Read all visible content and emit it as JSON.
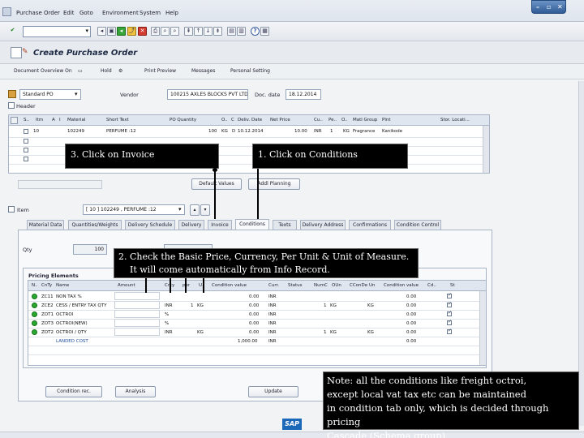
{
  "menubar": {
    "items": [
      "Purchase Order",
      "Edit",
      "Goto",
      "Environment",
      "System",
      "Help"
    ]
  },
  "title": "Create Purchase Order",
  "appbar": {
    "buttons": [
      "Document Overview On",
      "Hold",
      "Print Preview",
      "Messages",
      "Personal Setting"
    ]
  },
  "header_fields": {
    "doc_type": "Standard PO",
    "vendor_label": "Vendor",
    "vendor": "100215 AXLES BLOCKS PVT LTD",
    "doc_date_label": "Doc. date",
    "doc_date": "18.12.2014",
    "header_label": "Header"
  },
  "item_grid": {
    "columns": [
      "S..",
      "Itm",
      "A",
      "I",
      "Material",
      "Short Text",
      "PO Quantity",
      "O..",
      "C",
      "Deliv. Date",
      "Net Price",
      "Cu..",
      "Pe..",
      "O..",
      "Matl Group",
      "Plnt",
      "Stor. Locati..."
    ],
    "row": {
      "itm": "10",
      "material": "102249",
      "short_text": "PERFUME :12",
      "qty": "100",
      "oun": "KG",
      "c": "D",
      "date": "10.12.2014",
      "price": "10.00",
      "cur": "INR",
      "per": "1",
      "opu": "KG",
      "group": "Fragrance",
      "plant": "Kanikode"
    }
  },
  "buttons": {
    "default_values": "Default Values",
    "addl_planning": "Addl Planning"
  },
  "item_select": {
    "label": "Item",
    "value": "[ 10 ] 102249 , PERFUME :12"
  },
  "tabs": [
    "Material Data",
    "Quantities/Weights",
    "Delivery Schedule",
    "Delivery",
    "Invoice",
    "Conditions",
    "Texts",
    "Delivery Address",
    "Confirmations",
    "Condition Control"
  ],
  "qty_label": "Qty",
  "qty_value": "100",
  "pricing": {
    "group_label": "Pricing Elements",
    "columns": [
      "N..",
      "CnTy",
      "Name",
      "Amount",
      "Crcy",
      "per",
      "U..",
      "Condition value",
      "Curr.",
      "Status",
      "NumC",
      "OUn",
      "CConDe",
      "Un",
      "Condition value",
      "Cd..",
      "St"
    ],
    "rows": [
      {
        "cnty": "ZC11",
        "name": "NON TAX %",
        "crcy": "",
        "per": "",
        "u": "",
        "value": "0.00",
        "curr": "INR",
        "numc": "",
        "oun": "",
        "un": "",
        "value2": "0.00"
      },
      {
        "cnty": "ZCE2",
        "name": "CESS / ENTRY TAX QTY",
        "crcy": "INR",
        "per": "1",
        "u": "KG",
        "value": "0.00",
        "curr": "INR",
        "numc": "1",
        "oun": "KG",
        "un": "KG",
        "value2": "0.00"
      },
      {
        "cnty": "ZOT1",
        "name": "OCTROI",
        "crcy": "%",
        "per": "",
        "u": "",
        "value": "0.00",
        "curr": "INR",
        "numc": "",
        "oun": "",
        "un": "",
        "value2": "0.00"
      },
      {
        "cnty": "ZOT3",
        "name": "OCTROI(NEW)",
        "crcy": "%",
        "per": "",
        "u": "",
        "value": "0.00",
        "curr": "INR",
        "numc": "",
        "oun": "",
        "un": "",
        "value2": "0.00"
      },
      {
        "cnty": "ZOT2",
        "name": "OCTROI / QTY",
        "crcy": "INR",
        "per": "",
        "u": "KG",
        "value": "0.00",
        "curr": "INR",
        "numc": "1",
        "oun": "KG",
        "un": "KG",
        "value2": "0.00"
      },
      {
        "cnty": "",
        "name": "LANDED COST",
        "crcy": "",
        "per": "",
        "u": "",
        "value": "1,000.00",
        "curr": "INR",
        "numc": "",
        "oun": "",
        "un": "",
        "value2": "0.00"
      }
    ]
  },
  "bottom_buttons": {
    "condition_rec": "Condition rec.",
    "analysis": "Analysis",
    "update": "Update"
  },
  "callouts": {
    "invoice": "3. Click on Invoice",
    "conditions": "1. Click on Conditions",
    "pricing_line1": "2. Check the Basic Price, Currency, Per Unit & Unit of Measure.",
    "pricing_line2": "It will come automatically from Info Record.",
    "note_lines": [
      "Note: all the conditions like  freight octroi,",
      "except local vat tax etc can be maintained",
      "in condition tab only, which is decided through pricing",
      "Cascade (Schema group)"
    ]
  },
  "footer_logo": "SAP",
  "colors": {
    "active_led": "#2aa830",
    "title_text": "#1d2a44",
    "callout_bg": "#000000"
  }
}
